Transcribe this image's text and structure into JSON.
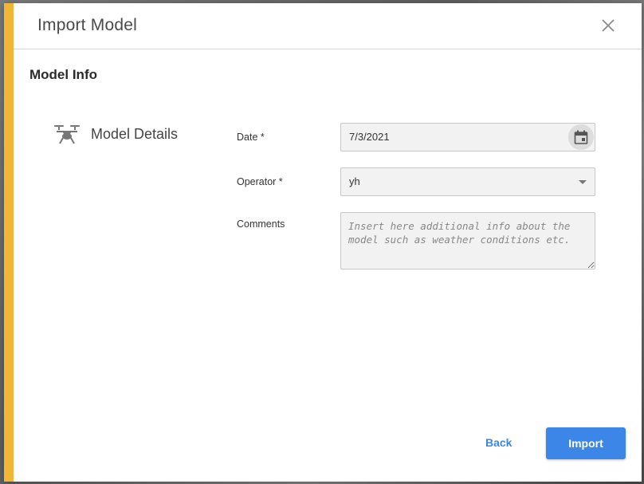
{
  "dialog": {
    "title": "Import Model",
    "close_icon": "close-icon",
    "accent_color": "#f2b637"
  },
  "section": {
    "title": "Model Info"
  },
  "sidebar": {
    "icon": "drone-icon",
    "label": "Model Details"
  },
  "form": {
    "date_label": "Date *",
    "date_value": "7/3/2021",
    "date_icon": "calendar-icon",
    "operator_label": "Operator *",
    "operator_value": "yh",
    "comments_label": "Comments",
    "comments_placeholder": "Insert here additional info about the model such as weather conditions etc."
  },
  "actions": {
    "back_label": "Back",
    "import_label": "Import",
    "primary_color": "#3b86e6"
  }
}
